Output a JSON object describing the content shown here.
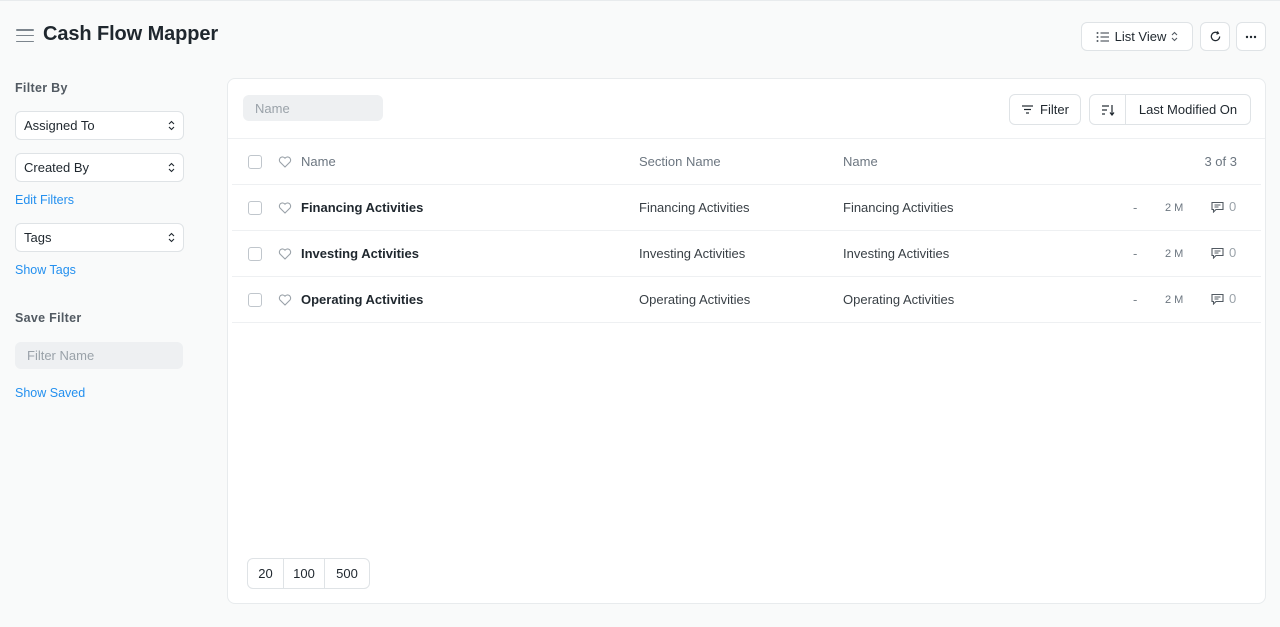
{
  "header": {
    "title": "Cash Flow Mapper",
    "view_label": "List View",
    "menu_icon": "hamburger-icon",
    "refresh_icon": "refresh-icon",
    "more_icon": "more-horizontal-icon"
  },
  "sidebar": {
    "filter_by_label": "Filter By",
    "assigned_to": "Assigned To",
    "created_by": "Created By",
    "edit_filters": "Edit Filters",
    "tags": "Tags",
    "show_tags": "Show Tags",
    "save_filter_label": "Save Filter",
    "filter_name_placeholder": "Filter Name",
    "show_saved": "Show Saved"
  },
  "toolbar": {
    "search_placeholder": "Name",
    "filter_label": "Filter",
    "sort_label": "Last Modified On"
  },
  "table": {
    "columns": [
      "Name",
      "Section Name",
      "Name"
    ],
    "count": "3 of 3",
    "rows": [
      {
        "name": "Financing Activities",
        "section_name": "Financing Activities",
        "name2": "Financing Activities",
        "assigned": "-",
        "modified": "2 M",
        "comments": "0"
      },
      {
        "name": "Investing Activities",
        "section_name": "Investing Activities",
        "name2": "Investing Activities",
        "assigned": "-",
        "modified": "2 M",
        "comments": "0"
      },
      {
        "name": "Operating Activities",
        "section_name": "Operating Activities",
        "name2": "Operating Activities",
        "assigned": "-",
        "modified": "2 M",
        "comments": "0"
      }
    ]
  },
  "paging": [
    "20",
    "100",
    "500"
  ],
  "colors": {
    "accent_link": "#2490ef",
    "text": "#1f272e",
    "background": "#f9fafa",
    "border": "#dfe3e6"
  }
}
